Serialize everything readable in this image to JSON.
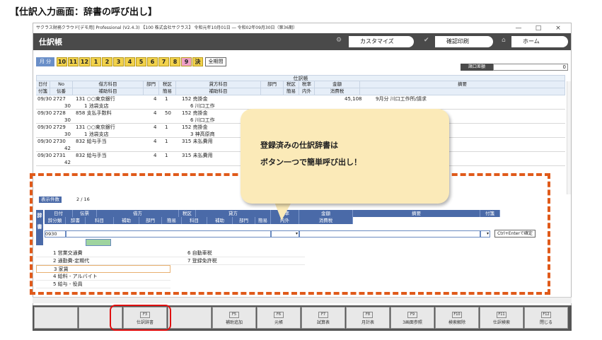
{
  "heading": "【仕訳入力画面：辞書の呼び出し】",
  "window": {
    "title": "サクラス財務クラウド[デモ用] Professional (V2.4.3) 【100 株式会社サクラス】 令和元年10月01日 ― 令和02年09月30日（第36期）",
    "minimize": "—",
    "maximize": "□",
    "close": "×"
  },
  "appbar": {
    "name": "仕訳帳",
    "customize": "カスタマイズ",
    "print": "確認印刷",
    "home": "ホーム"
  },
  "months": {
    "label": "月 分",
    "items": [
      "10",
      "11",
      "12",
      "1",
      "2",
      "3",
      "4",
      "5",
      "6",
      "7",
      "8",
      "9",
      "決"
    ],
    "all_period": "全期間"
  },
  "discrepancy": {
    "label": "諸口差額",
    "value": "0"
  },
  "ledger": {
    "title": "仕訳帳",
    "headers_top": [
      "日付",
      "No",
      "借方科目",
      "部門",
      "税区",
      "貸方科目",
      "部門",
      "税区",
      "税率",
      "金額",
      "摘要"
    ],
    "headers_bottom": [
      "付箋",
      "伝番",
      "補助科目",
      "",
      "簡易",
      "補助科目",
      "",
      "簡易",
      "内外",
      "消費税",
      ""
    ],
    "rows": [
      {
        "date": "09/30",
        "no": "2727",
        "sub": "30",
        "debit": "131 ○○東京銀行",
        "debit_sub": "1 池袋支店",
        "dept": "4",
        "tax": "1",
        "credit": "152 売掛金",
        "credit_sub": "6 川口工作"
      },
      {
        "date": "09/30",
        "no": "2728",
        "sub": "30",
        "debit": "858 支払手数料",
        "debit_sub": "",
        "dept": "4",
        "tax": "50",
        "credit": "152 売掛金",
        "credit_sub": "6 川口工作"
      },
      {
        "date": "09/30",
        "no": "2729",
        "sub": "30",
        "debit": "131 ○○東京銀行",
        "debit_sub": "1 池袋支店",
        "dept": "4",
        "tax": "1",
        "credit": "152 売掛金",
        "credit_sub": "3 神高原商"
      },
      {
        "date": "09/30",
        "no": "2730",
        "sub": "42",
        "debit": "832 給与手当",
        "debit_sub": "",
        "dept": "4",
        "tax": "1",
        "credit": "315 未払費用",
        "credit_sub": ""
      },
      {
        "date": "09/30",
        "no": "2731",
        "sub": "42",
        "debit": "832 給与手当",
        "debit_sub": "",
        "dept": "4",
        "tax": "1",
        "credit": "315 未払費用",
        "credit_sub": ""
      }
    ],
    "partial_amount": "45,108",
    "partial_memo": "9月分 川口工作所/請求"
  },
  "dictionary": {
    "count_label": "表示件数",
    "count_value": "2 / 16",
    "side_label_1": "辞",
    "side_label_2": "書",
    "headers_top": [
      "日付",
      "伝票",
      "借方",
      "税区",
      "貸方",
      "税率",
      "金額",
      "摘要",
      "付箋"
    ],
    "headers_bottom": [
      "辞分類",
      "辞書",
      "科目",
      "補助",
      "部門",
      "簡易",
      "科目",
      "補助",
      "部門",
      "簡易",
      "内外",
      "消費税"
    ],
    "date_value": "0930",
    "confirm_button": "Ctrl+Enterで確定",
    "list": [
      "1 営業交通費",
      "2 通勤費-定期代",
      "3 家賃",
      "4 給料 - アルバイト",
      "5 給与 - 役員"
    ],
    "list_right": [
      "6 自動車税",
      "7 登録免許税"
    ]
  },
  "callout": {
    "line1": "登録済みの仕訳辞書は",
    "line2": "ボタン一つで簡単呼び出し！"
  },
  "fkeys": [
    {
      "key": "",
      "label": ""
    },
    {
      "key": "",
      "label": ""
    },
    {
      "key": "F3",
      "label": "仕訳辞書"
    },
    {
      "key": "",
      "label": ""
    },
    {
      "key": "F5",
      "label": "補助追加"
    },
    {
      "key": "F6",
      "label": "元帳"
    },
    {
      "key": "F7",
      "label": "試算表"
    },
    {
      "key": "F8",
      "label": "月計表"
    },
    {
      "key": "F9",
      "label": "3画面参照"
    },
    {
      "key": "F10",
      "label": "検索解除"
    },
    {
      "key": "F11",
      "label": "仕訳検索"
    },
    {
      "key": "F12",
      "label": "閉じる"
    }
  ],
  "colors": {
    "accent": "#4a6aa8",
    "month": "#f2d24b",
    "highlight": "#e05a1a",
    "callout": "#fbeab8",
    "red": "#e01010"
  }
}
